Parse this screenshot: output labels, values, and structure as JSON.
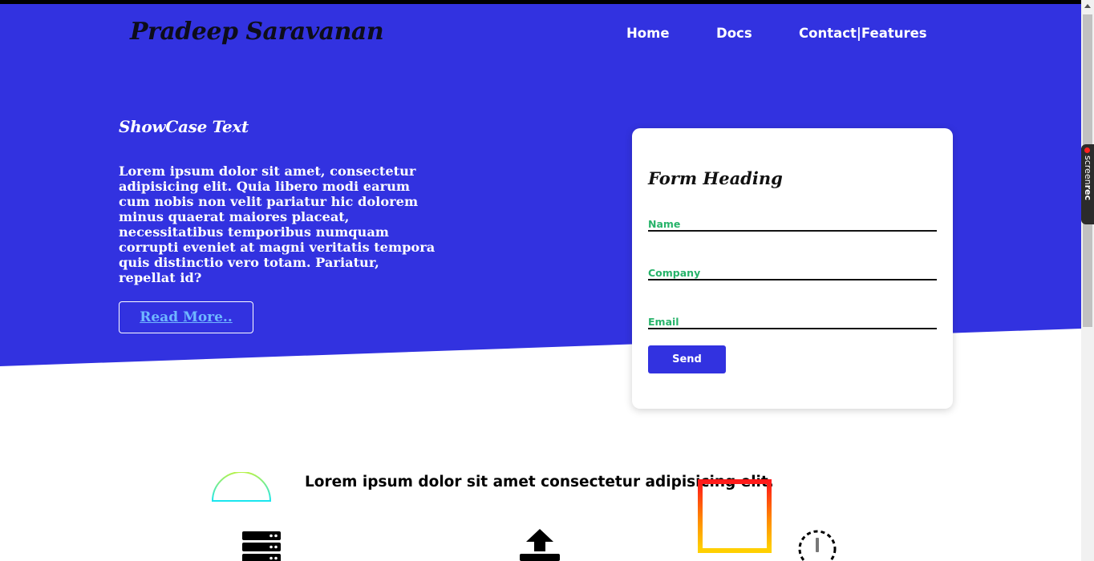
{
  "header": {
    "brand": "Pradeep Saravanan",
    "nav": [
      "Home",
      "Docs",
      "Contact|Features"
    ]
  },
  "showcase": {
    "title": "ShowCase Text",
    "text": "Lorem ipsum dolor sit amet, consectetur adipisicing elit. Quia libero modi earum cum nobis non velit pariatur hic dolorem minus quaerat maiores placeat, necessitatibus temporibus numquam corrupti eveniet at magni veritatis tempora quis distinctio vero totam. Pariatur, repellat id?",
    "read_more": "Read More.."
  },
  "form": {
    "heading": "Form Heading",
    "name_label": "Name",
    "company_label": "Company",
    "email_label": "Email",
    "send_label": "Send"
  },
  "features": {
    "heading": "Lorem ipsum dolor sit amet consectetur adipisicing elit.",
    "icons": [
      "dome-icon",
      "server-icon",
      "upload-icon",
      "gradient-square-icon",
      "alert-icon"
    ]
  },
  "recorder": {
    "label_light": "screen",
    "label_bold": "rec"
  },
  "colors": {
    "primary": "#3232e0",
    "label_green": "#27b36a",
    "link_blue": "#6fb7ff"
  }
}
